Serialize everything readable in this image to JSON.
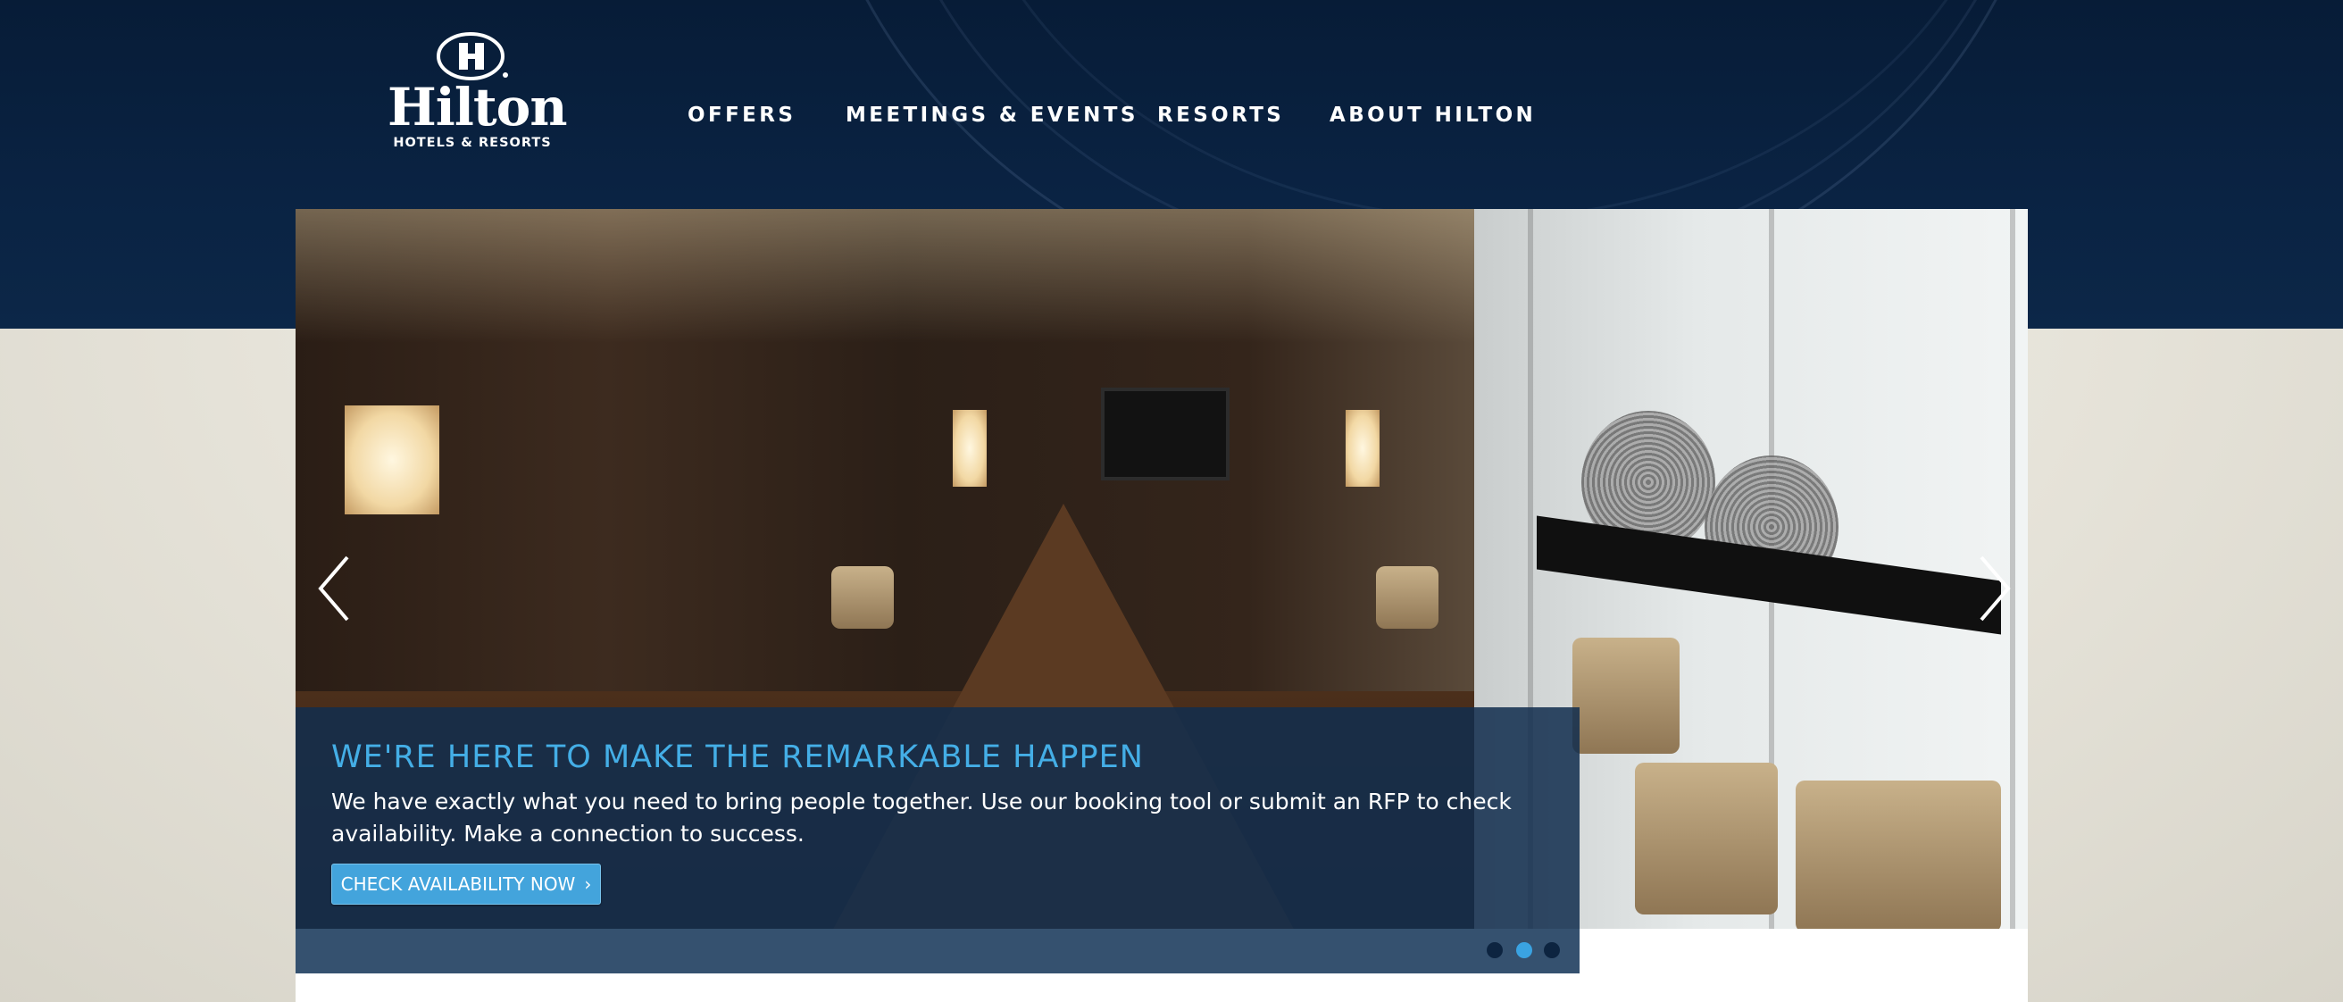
{
  "brand": {
    "name": "Hilton",
    "tagline": "HOTELS & RESORTS"
  },
  "nav": {
    "items": [
      {
        "label": "OFFERS"
      },
      {
        "label": "MEETINGS & EVENTS"
      },
      {
        "label": "RESORTS"
      },
      {
        "label": "ABOUT HILTON"
      }
    ]
  },
  "hero": {
    "title": "WE'RE HERE TO MAKE THE REMARKABLE HAPPEN",
    "text": "We have exactly what you need to bring people together. Use our booking tool or submit an RFP to check availability. Make a connection to success.",
    "cta_label": "CHECK AVAILABILITY NOW",
    "slides_total": 3,
    "active_slide": 2
  },
  "colors": {
    "header_navy": "#0a2343",
    "accent_blue": "#44aee6",
    "button_blue": "#43a4dc",
    "caption_overlay": "#122d4e"
  },
  "icons": [
    "hilton-logo-icon",
    "arrow-left-icon",
    "arrow-right-icon",
    "chevron-right-icon"
  ]
}
